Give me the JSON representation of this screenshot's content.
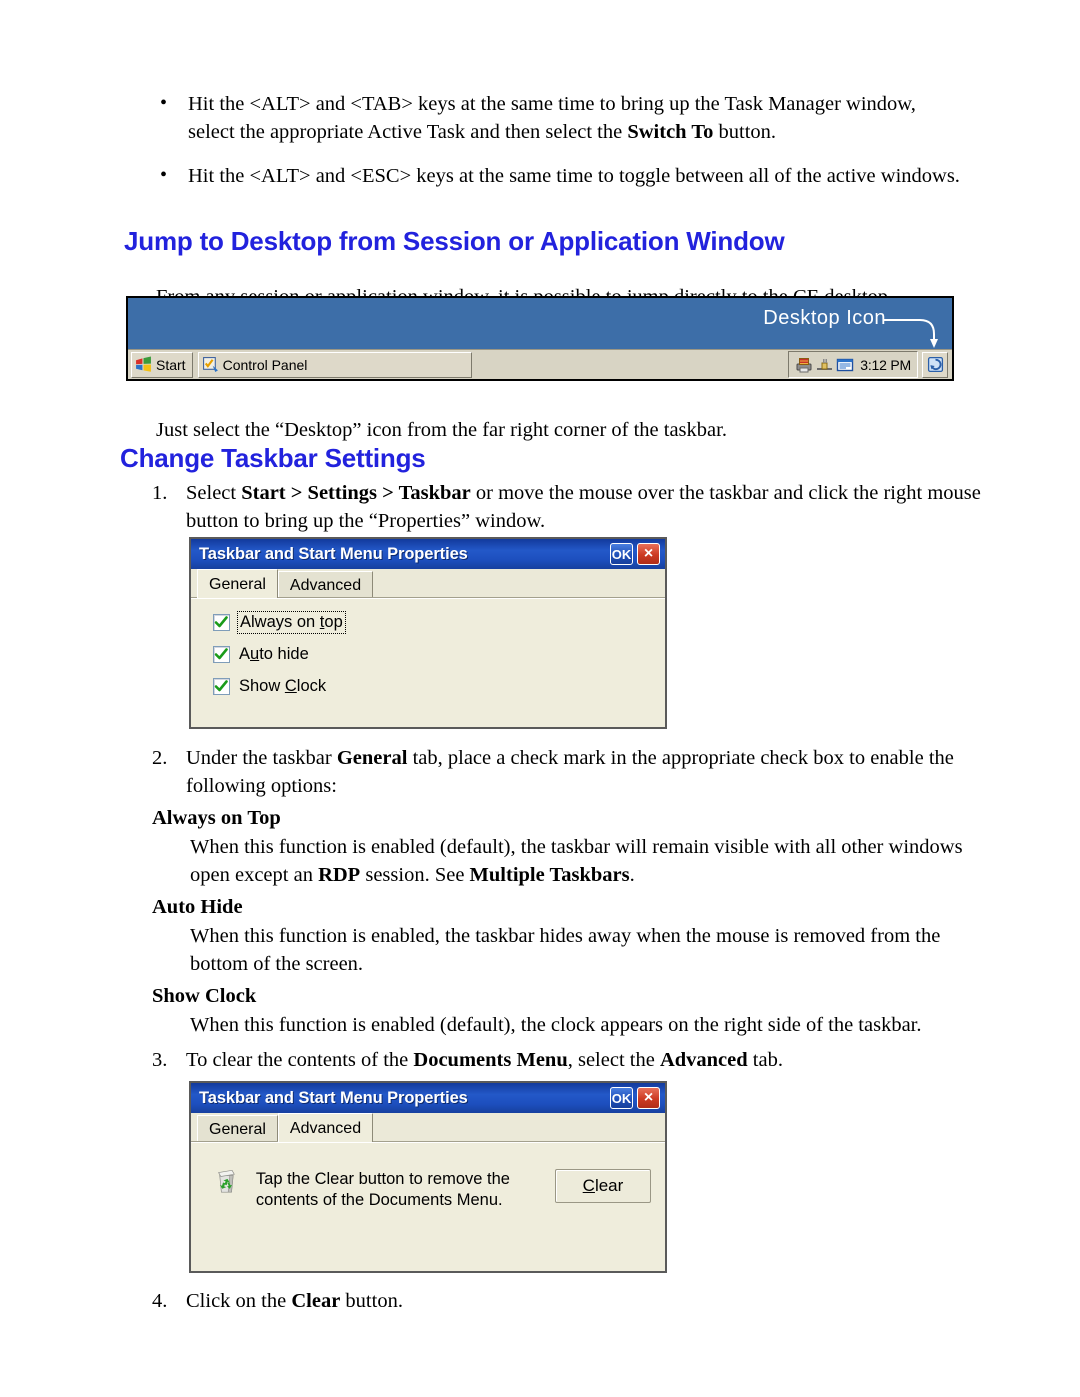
{
  "bullets": [
    {
      "parts": [
        {
          "t": "Hit the <ALT> and <TAB> keys at the same time to bring up the Task Manager window, select the appropriate Active Task and then select the ",
          "b": false
        },
        {
          "t": "Switch To",
          "b": true
        },
        {
          "t": " button.",
          "b": false
        }
      ]
    },
    {
      "parts": [
        {
          "t": "Hit the <ALT> and <ESC> keys at the same time to toggle between all of the active windows.",
          "b": false
        }
      ]
    }
  ],
  "headings": {
    "jump": "Jump to Desktop from Session or Application Window",
    "change": "Change Taskbar Settings"
  },
  "paragraphs": {
    "jump_intro": "From any session or application window, it is possible to jump directly to the CE desktop.",
    "jump_after": "Just select the “Desktop” icon from the far right corner of the taskbar."
  },
  "taskbar_figure": {
    "callout_label": "Desktop Icon",
    "start_label": "Start",
    "task_label": "Control Panel",
    "clock": "3:12 PM",
    "tray_icons": [
      "printer-icon",
      "plug-icon",
      "input-panel-icon"
    ],
    "desktop_icon": "desktop-icon",
    "blue_color": "#3d6ea8",
    "strip_color": "#d8d4c4"
  },
  "steps": [
    {
      "num": "1.",
      "parts": [
        {
          "t": "Select ",
          "b": false
        },
        {
          "t": "Start > Settings > Taskbar",
          "b": true
        },
        {
          "t": " or move the mouse over the taskbar and click the right mouse button to bring up the “Properties” window.",
          "b": false
        }
      ]
    },
    {
      "num": "2.",
      "parts": [
        {
          "t": "Under the taskbar ",
          "b": false
        },
        {
          "t": "General",
          "b": true
        },
        {
          "t": " tab, place a check mark in the appropriate check box to enable the following options:",
          "b": false
        }
      ]
    },
    {
      "num": "3.",
      "parts": [
        {
          "t": "To clear the contents of the ",
          "b": false
        },
        {
          "t": "Documents Menu",
          "b": true
        },
        {
          "t": ", select the ",
          "b": false
        },
        {
          "t": "Advanced",
          "b": true
        },
        {
          "t": " tab.",
          "b": false
        }
      ]
    },
    {
      "num": "4.",
      "parts": [
        {
          "t": "Click on the ",
          "b": false
        },
        {
          "t": "Clear",
          "b": true
        },
        {
          "t": " button.",
          "b": false
        }
      ]
    }
  ],
  "options": [
    {
      "head": "Always on Top",
      "parts": [
        {
          "t": "When this function is enabled (default), the taskbar will remain visible with all other windows open except an ",
          "b": false
        },
        {
          "t": "RDP",
          "b": true
        },
        {
          "t": " session.  See ",
          "b": false
        },
        {
          "t": "Multiple Taskbars",
          "b": true
        },
        {
          "t": ".",
          "b": false
        }
      ]
    },
    {
      "head": "Auto Hide",
      "parts": [
        {
          "t": "When this function is enabled, the taskbar hides away when the mouse is removed from the bottom of the screen.",
          "b": false
        }
      ]
    },
    {
      "head": "Show Clock",
      "parts": [
        {
          "t": "When this function is enabled (default), the clock appears on the right side of the taskbar.",
          "b": false
        }
      ]
    }
  ],
  "dialog_general": {
    "title": "Taskbar and Start Menu Properties",
    "ok_label": "OK",
    "close_label": "×",
    "tabs": [
      {
        "label": "General",
        "active": true
      },
      {
        "label": "Advanced",
        "active": false
      }
    ],
    "checkboxes": [
      {
        "pre": "Always on ",
        "accel": "t",
        "post": "op",
        "checked": true,
        "focused": true
      },
      {
        "pre": "A",
        "accel": "u",
        "post": "to hide",
        "checked": true,
        "focused": false
      },
      {
        "pre": "Show ",
        "accel": "C",
        "post": "lock",
        "checked": true,
        "focused": false
      }
    ]
  },
  "dialog_advanced": {
    "title": "Taskbar and Start Menu Properties",
    "ok_label": "OK",
    "close_label": "×",
    "tabs": [
      {
        "label": "General",
        "active": false
      },
      {
        "label": "Advanced",
        "active": true
      }
    ],
    "message": "Tap the Clear button to remove the contents of the Documents Menu.",
    "icon": "recycle-bin-icon",
    "clear_button": {
      "pre": "",
      "accel": "C",
      "post": "lear"
    }
  },
  "colors": {
    "heading": "#2222dd",
    "titlebar": "#1d4fbe",
    "dialog_face": "#efeddc"
  }
}
